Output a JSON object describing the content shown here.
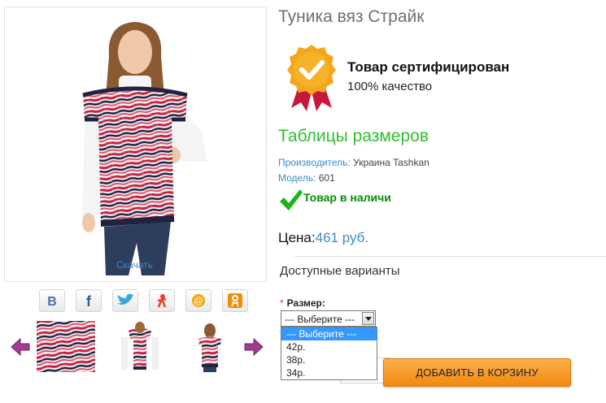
{
  "product": {
    "title": "Туника вяз Страйк",
    "download_label": "Скачать",
    "main_image": "product-photo-girl-striped-tunic",
    "social": [
      {
        "icon": "vk-icon",
        "text": "B"
      },
      {
        "icon": "facebook-icon",
        "text": "f"
      },
      {
        "icon": "twitter-icon",
        "text": ""
      },
      {
        "icon": "odnoklassniki-icon",
        "text": ""
      },
      {
        "icon": "mailru-icon",
        "text": "@"
      },
      {
        "icon": "ok-icon",
        "text": ""
      }
    ],
    "thumbnails": [
      "fabric-closeup",
      "tunic-front",
      "tunic-model"
    ],
    "certificate": {
      "title": "Товар сертифицирован",
      "subtitle": "100% качество"
    },
    "size_table_link": "Таблицы размеров",
    "manufacturer": {
      "label": "Производитель:",
      "value": "Украина Tashkan"
    },
    "model": {
      "label": "Модель:",
      "value": "601"
    },
    "stock_status": "Товар в наличи",
    "price": {
      "label": "Цена:",
      "value": "461 руб."
    },
    "options_title": "Доступные варианты",
    "size": {
      "required_mark": "*",
      "label": "Размер:",
      "selected": "--- Выберите ---",
      "options": [
        "--- Выберите ---",
        "42р.",
        "38р.",
        "34р."
      ]
    },
    "add_to_cart": "ДОБАВИТЬ В КОРЗИНУ"
  },
  "colors": {
    "link": "#3d8cc9",
    "accent_green": "#2fbf2f",
    "stock_green": "#0a8a0a",
    "button_orange": "#f2880e",
    "stripe_red": "#c8213f",
    "stripe_navy": "#1f2340"
  }
}
